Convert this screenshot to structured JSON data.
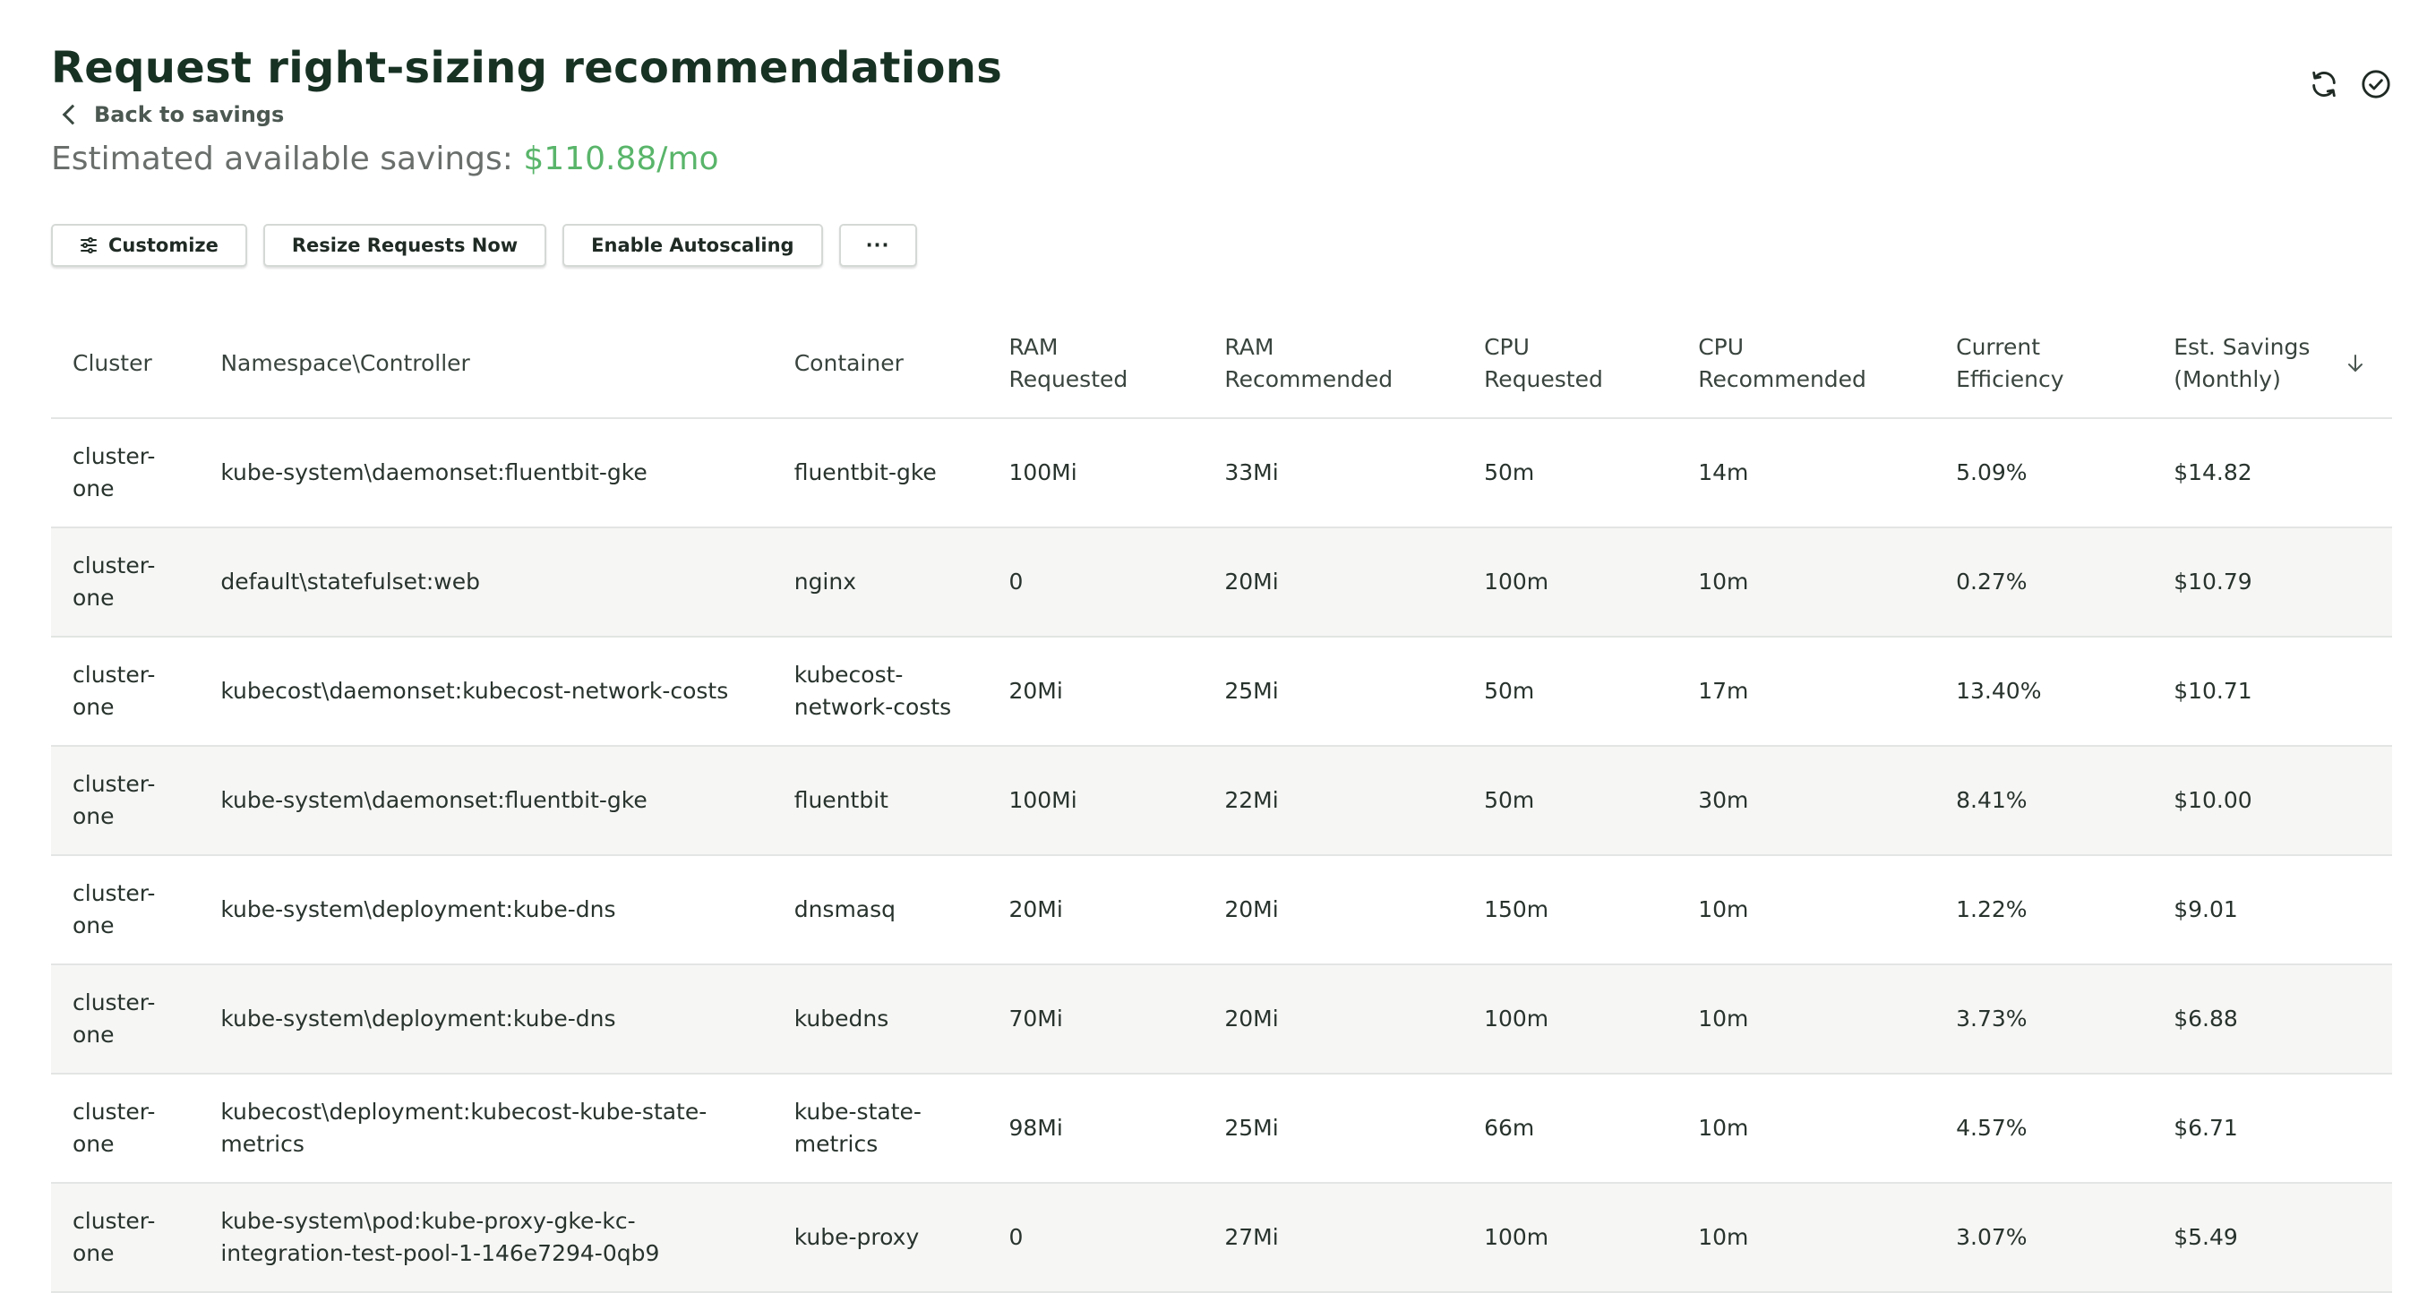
{
  "header": {
    "title": "Request right-sizing recommendations",
    "back_label": "Back to savings",
    "savings_label": "Estimated available savings: ",
    "savings_amount": "$110.88/mo"
  },
  "top_icons": [
    "refresh-icon",
    "check-circle-icon"
  ],
  "toolbar": {
    "customize_label": "Customize",
    "resize_label": "Resize Requests Now",
    "autoscale_label": "Enable Autoscaling",
    "more_label": "···"
  },
  "colors": {
    "title": "#173123",
    "savings_amount": "#59b56a",
    "row_alt": "#f6f6f5",
    "border": "#e2e5e3"
  },
  "table": {
    "columns": [
      {
        "line1": "Cluster",
        "line2": ""
      },
      {
        "line1": "Namespace\\Controller",
        "line2": ""
      },
      {
        "line1": "Container",
        "line2": ""
      },
      {
        "line1": "RAM",
        "line2": "Requested"
      },
      {
        "line1": "RAM",
        "line2": "Recommended"
      },
      {
        "line1": "CPU",
        "line2": "Requested"
      },
      {
        "line1": "CPU",
        "line2": "Recommended"
      },
      {
        "line1": "Current",
        "line2": "Efficiency"
      },
      {
        "line1": "Est. Savings",
        "line2": "(Monthly)"
      }
    ],
    "sort_indicator": "arrow-down-icon",
    "rows": [
      {
        "cluster_a": "cluster-",
        "cluster_b": "one",
        "ns": "kube-system\\daemonset:fluentbit-gke",
        "container": "fluentbit-gke",
        "ram_req": "100Mi",
        "ram_rec": "33Mi",
        "cpu_req": "50m",
        "cpu_rec": "14m",
        "eff": "5.09%",
        "sav": "$14.82"
      },
      {
        "cluster_a": "cluster-",
        "cluster_b": "one",
        "ns": "default\\statefulset:web",
        "container": "nginx",
        "ram_req": "0",
        "ram_rec": "20Mi",
        "cpu_req": "100m",
        "cpu_rec": "10m",
        "eff": "0.27%",
        "sav": "$10.79"
      },
      {
        "cluster_a": "cluster-",
        "cluster_b": "one",
        "ns": "kubecost\\daemonset:kubecost-network-costs",
        "container": "kubecost-network-costs",
        "ram_req": "20Mi",
        "ram_rec": "25Mi",
        "cpu_req": "50m",
        "cpu_rec": "17m",
        "eff": "13.40%",
        "sav": "$10.71"
      },
      {
        "cluster_a": "cluster-",
        "cluster_b": "one",
        "ns": "kube-system\\daemonset:fluentbit-gke",
        "container": "fluentbit",
        "ram_req": "100Mi",
        "ram_rec": "22Mi",
        "cpu_req": "50m",
        "cpu_rec": "30m",
        "eff": "8.41%",
        "sav": "$10.00"
      },
      {
        "cluster_a": "cluster-",
        "cluster_b": "one",
        "ns": "kube-system\\deployment:kube-dns",
        "container": "dnsmasq",
        "ram_req": "20Mi",
        "ram_rec": "20Mi",
        "cpu_req": "150m",
        "cpu_rec": "10m",
        "eff": "1.22%",
        "sav": "$9.01"
      },
      {
        "cluster_a": "cluster-",
        "cluster_b": "one",
        "ns": "kube-system\\deployment:kube-dns",
        "container": "kubedns",
        "ram_req": "70Mi",
        "ram_rec": "20Mi",
        "cpu_req": "100m",
        "cpu_rec": "10m",
        "eff": "3.73%",
        "sav": "$6.88"
      },
      {
        "cluster_a": "cluster-",
        "cluster_b": "one",
        "ns": "kubecost\\deployment:kubecost-kube-state-metrics",
        "container": "kube-state-metrics",
        "ram_req": "98Mi",
        "ram_rec": "25Mi",
        "cpu_req": "66m",
        "cpu_rec": "10m",
        "eff": "4.57%",
        "sav": "$6.71"
      },
      {
        "cluster_a": "cluster-",
        "cluster_b": "one",
        "ns": "kube-system\\pod:kube-proxy-gke-kc-integration-test-pool-1-146e7294-0qb9",
        "container": "kube-proxy",
        "ram_req": "0",
        "ram_rec": "27Mi",
        "cpu_req": "100m",
        "cpu_rec": "10m",
        "eff": "3.07%",
        "sav": "$5.49"
      }
    ]
  }
}
